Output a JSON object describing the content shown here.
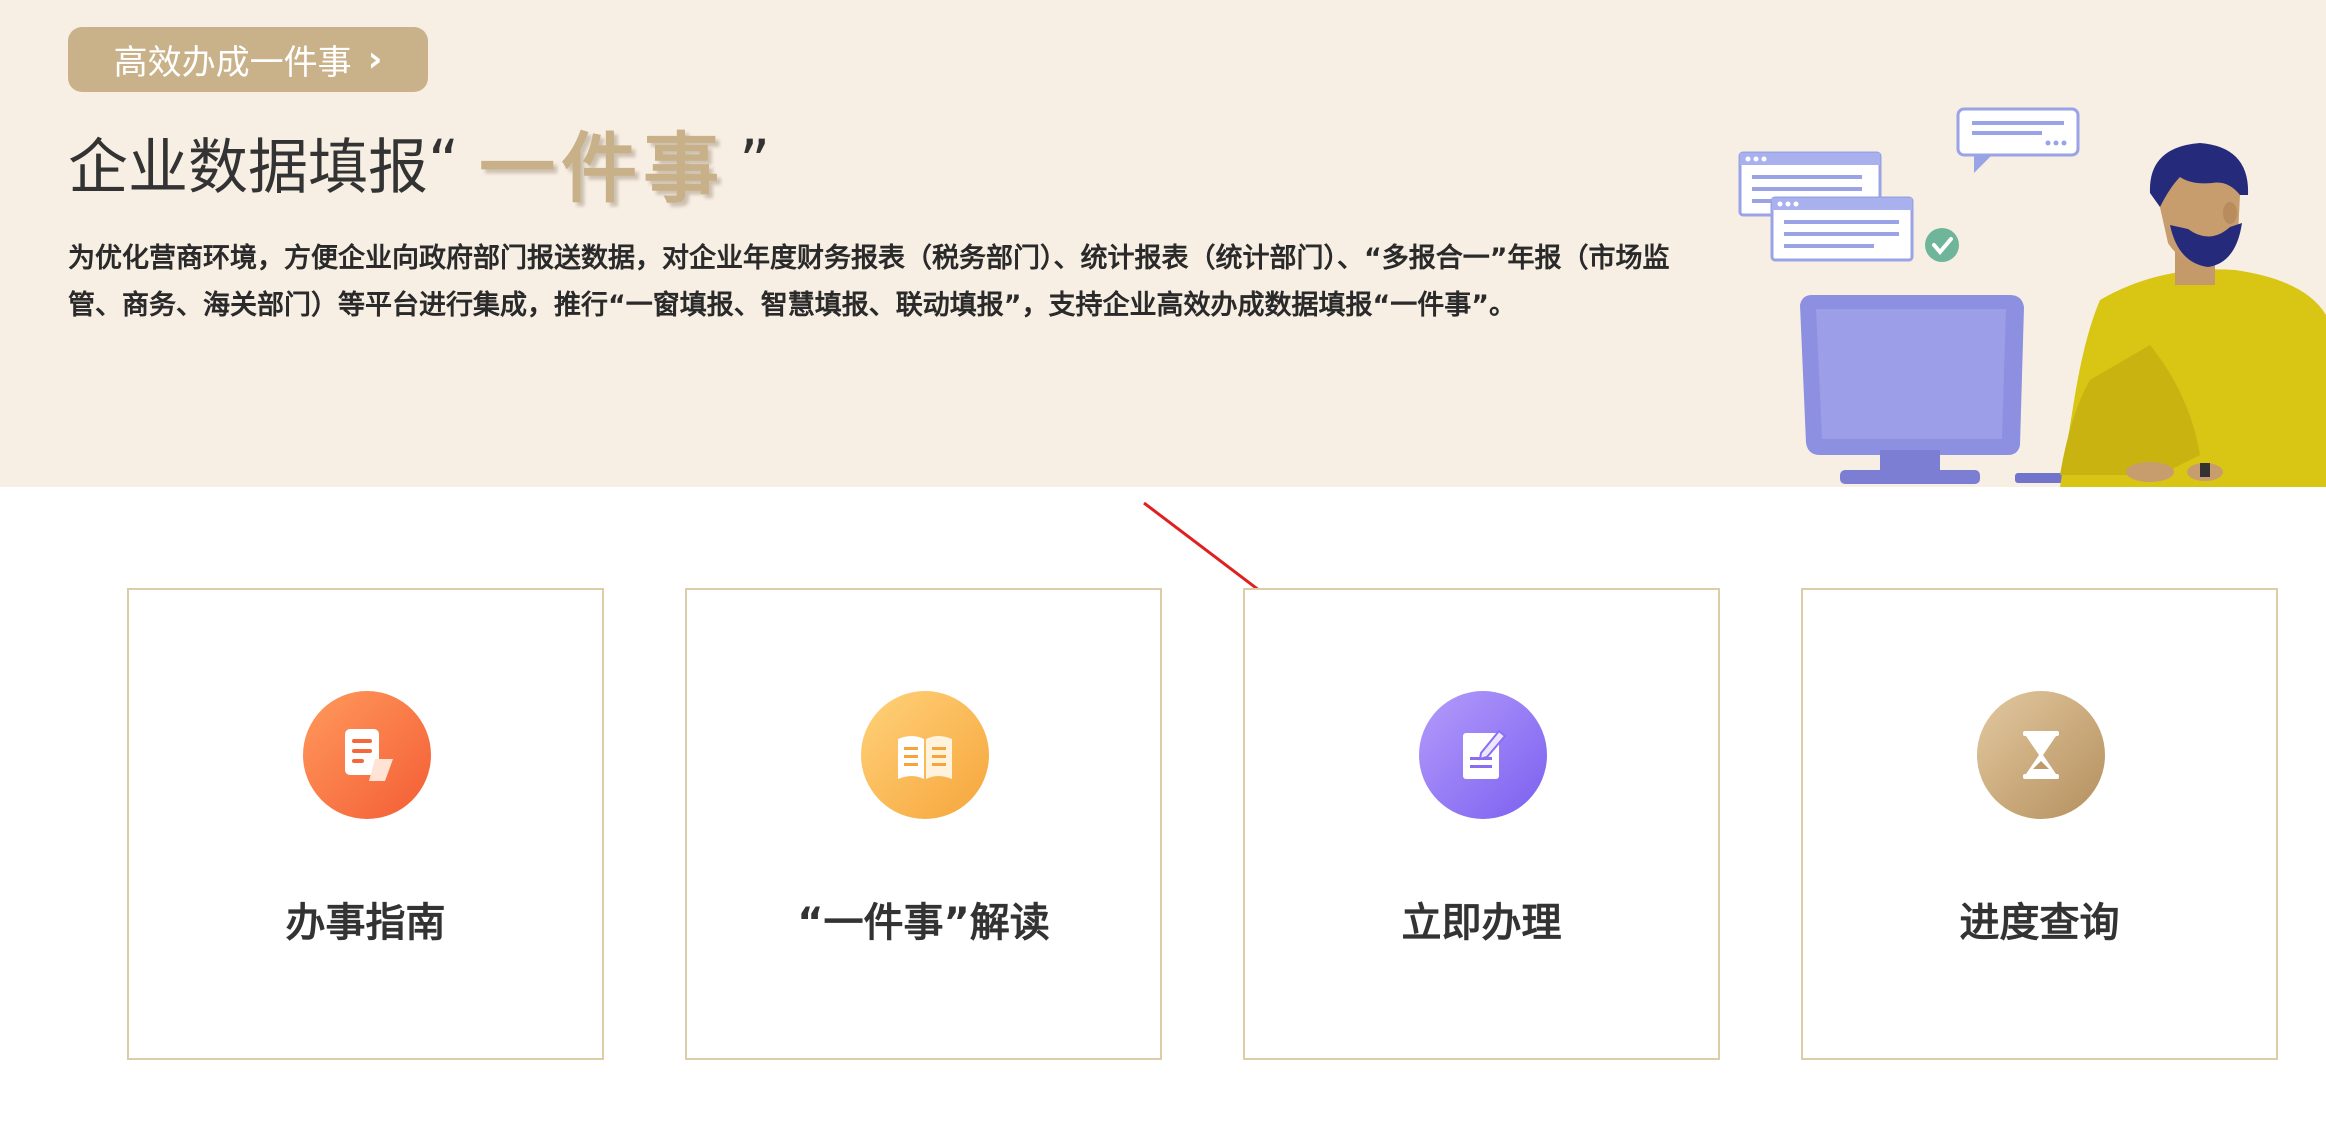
{
  "banner": {
    "tag_label": "高效办成一件事",
    "title_main": "企业数据填报",
    "title_open_quote": "“",
    "title_highlight": "一件事",
    "title_close_quote": "”",
    "description": "为优化营商环境，方便企业向政府部门报送数据，对企业年度财务报表（税务部门）、统计报表（统计部门）、“多报合一”年报（市场监管、商务、海关部门）等平台进行集成，推行“一窗填报、智慧填报、联动填报”，支持企业高效办成数据填报“一件事”。"
  },
  "cards": [
    {
      "label": "办事指南",
      "icon": "guide-document-icon",
      "color": "#f4683d"
    },
    {
      "label": "“一件事”解读",
      "icon": "open-book-icon",
      "color": "#f7ae45"
    },
    {
      "label": "立即办理",
      "icon": "edit-form-icon",
      "color": "#8a6df3"
    },
    {
      "label": "进度查询",
      "icon": "hourglass-icon",
      "color": "#c09a68"
    }
  ],
  "colors": {
    "banner_bg": "#f8efe4",
    "accent_gold": "#c9b28a",
    "card_border": "#ddcca8",
    "annotation_arrow": "#e02020"
  }
}
